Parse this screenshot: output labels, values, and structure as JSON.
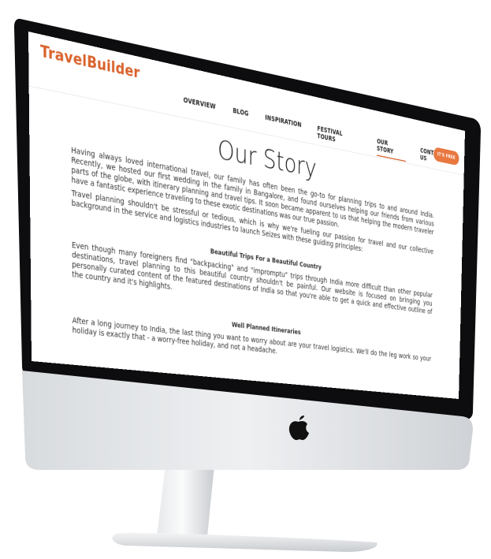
{
  "brand": {
    "name": "TravelBuilder",
    "accent": "#d9622b"
  },
  "nav": {
    "items": [
      {
        "label": "OVERVIEW"
      },
      {
        "label": "BLOG"
      },
      {
        "label": "INSPIRATION"
      },
      {
        "label": "FESTIVAL TOURS"
      },
      {
        "label": "OUR STORY"
      },
      {
        "label": "CONTACT US"
      }
    ],
    "cta_label": "IT'S FREE"
  },
  "page": {
    "title": "Our Story",
    "intro_paragraph": "Having always loved international travel, our family has often been the go-to for planning trips to and around India. Recently, we hosted our first wedding in the family in Bangalore, and found ourselves helping our friends from various parts of the globe, with itinerary planning and travel tips. It soon became apparent to us that helping the modern traveler have a fantastic experience traveling to these exotic destinations was our true passion.",
    "second_paragraph": "Travel planning shouldn't be stressful or tedious, which is why we're fueling our passion for travel and our collective background in the service and logistics industries to launch Seizes with these guiding principles:",
    "sections": [
      {
        "heading": "Beautiful Trips For a Beautiful Country",
        "body": "Even though many foreigners find \"backpacking\" and \"impromptu\" trips through India more difficult than other popular destinations, travel planning to this beautiful country shouldn't be painful. Our website is focused on bringing you personally curated content of the featured destinations of India so that you're able to get a quick and effective outline of the country and it's highlights."
      },
      {
        "heading": "Well Planned Itineraries",
        "body": "After a long journey to India, the last thing you want to worry about are your travel logistics. We'll do the leg work so your holiday is exactly that - a worry-free holiday, and not a headache."
      }
    ]
  },
  "device": {
    "logo": "apple-logo-icon"
  }
}
